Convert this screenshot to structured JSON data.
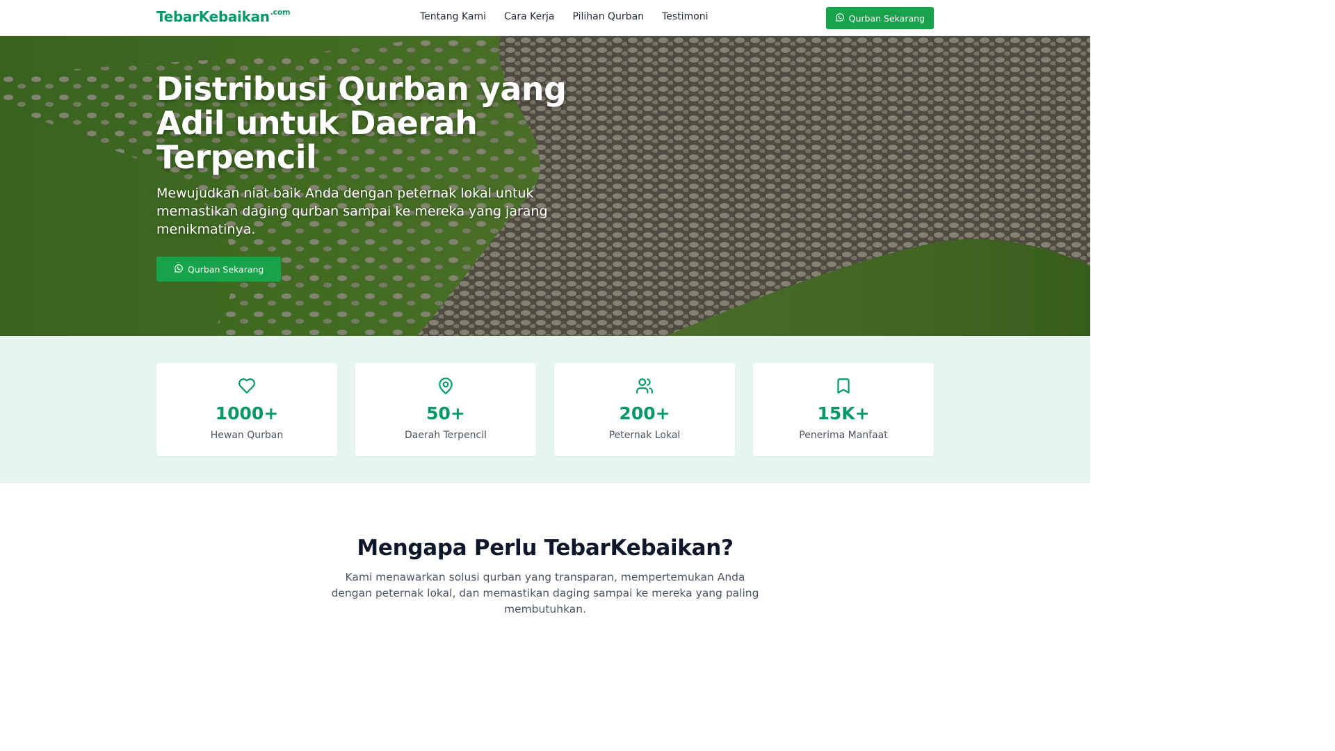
{
  "brand": {
    "name": "TebarKebaikan",
    "suffix": ".com",
    "color": "#059669"
  },
  "nav": {
    "links": [
      {
        "label": "Tentang Kami"
      },
      {
        "label": "Cara Kerja"
      },
      {
        "label": "Pilihan Qurban"
      },
      {
        "label": "Testimoni"
      }
    ],
    "cta_label": "Qurban Sekarang",
    "cta_icon": "whatsapp-icon"
  },
  "hero": {
    "title": "Distribusi Qurban yang Adil untuk Daerah Terpencil",
    "subtitle": "Mewujudkan niat baik Anda dengan peternak lokal untuk memastikan daging qurban sampai ke mereka yang jarang menikmatinya.",
    "cta_label": "Qurban Sekarang",
    "cta_icon": "whatsapp-icon"
  },
  "stats": [
    {
      "icon": "heart-icon",
      "value": "1000+",
      "label": "Hewan Qurban"
    },
    {
      "icon": "map-pin-icon",
      "value": "50+",
      "label": "Daerah Terpencil"
    },
    {
      "icon": "users-icon",
      "value": "200+",
      "label": "Peternak Lokal"
    },
    {
      "icon": "bookmark-icon",
      "value": "15K+",
      "label": "Penerima Manfaat"
    }
  ],
  "why": {
    "title": "Mengapa Perlu TebarKebaikan?",
    "text": "Kami menawarkan solusi qurban yang transparan, mempertemukan Anda dengan peternak lokal, dan memastikan daging sampai ke mereka yang paling membutuhkan."
  },
  "colors": {
    "accent": "#16a34a",
    "stats_bg": "#e6f5ee",
    "icon": "#059669"
  }
}
